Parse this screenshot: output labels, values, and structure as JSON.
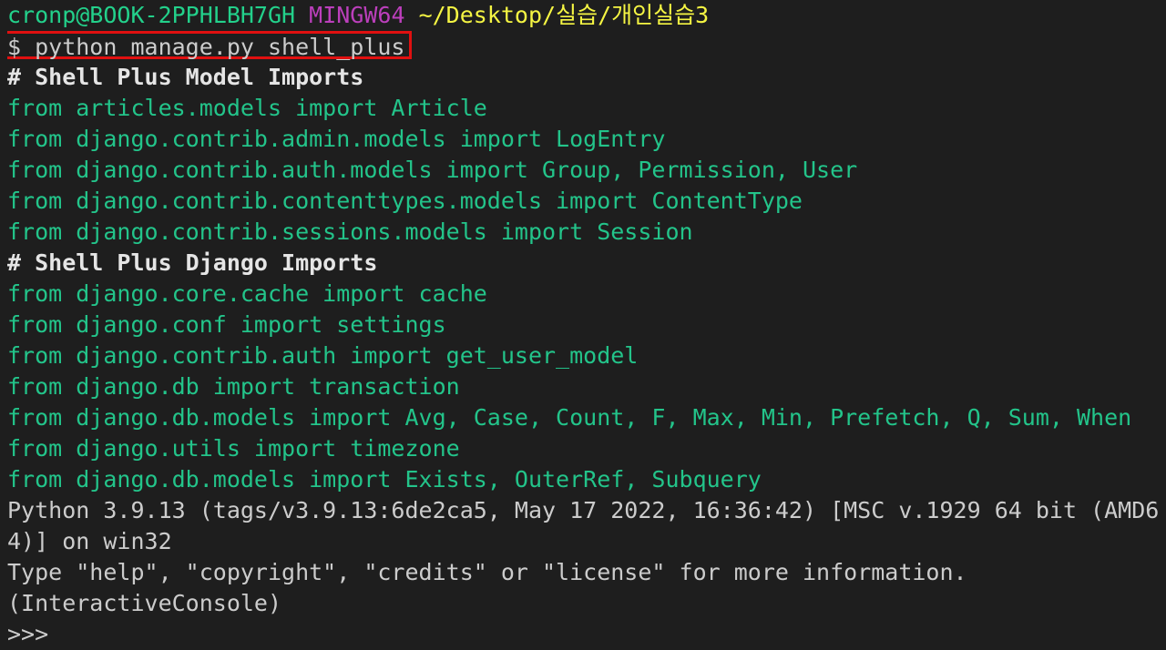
{
  "prompt": {
    "user_host": "cronp@BOOK-2PPHLBH7GH",
    "system": "MINGW64",
    "path": "~/Desktop/실습/개인실습3"
  },
  "command": "$ python manage.py shell_plus",
  "model_imports_header": "# Shell Plus Model Imports",
  "model_imports": [
    "from articles.models import Article",
    "from django.contrib.admin.models import LogEntry",
    "from django.contrib.auth.models import Group, Permission, User",
    "from django.contrib.contenttypes.models import ContentType",
    "from django.contrib.sessions.models import Session"
  ],
  "django_imports_header": "# Shell Plus Django Imports",
  "django_imports": [
    "from django.core.cache import cache",
    "from django.conf import settings",
    "from django.contrib.auth import get_user_model",
    "from django.db import transaction",
    "from django.db.models import Avg, Case, Count, F, Max, Min, Prefetch, Q, Sum, When",
    "from django.utils import timezone",
    "from django.db.models import Exists, OuterRef, Subquery"
  ],
  "banner": [
    "Python 3.9.13 (tags/v3.9.13:6de2ca5, May 17 2022, 16:36:42) [MSC v.1929 64 bit (AMD6",
    "4)] on win32",
    "Type \"help\", \"copyright\", \"credits\" or \"license\" for more information.",
    "(InteractiveConsole)"
  ],
  "repl_prompt": ">>>",
  "colors": {
    "background": "#1e1e1e",
    "import_green": "#23c48a",
    "user_green": "#23d18b",
    "system_magenta": "#bc3fbc",
    "path_yellow": "#f5f543",
    "highlight_red": "#e01010",
    "text": "#cccccc"
  }
}
